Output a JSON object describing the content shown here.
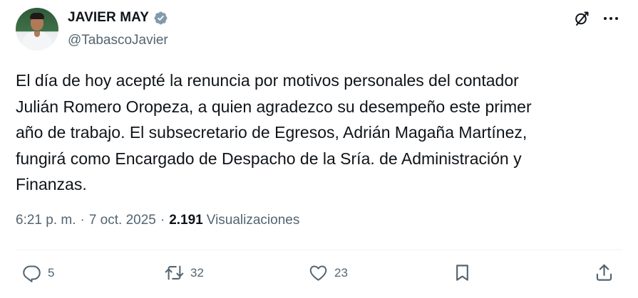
{
  "author": {
    "display_name": "JAVIER MAY",
    "handle": "@TabascoJavier",
    "verified": true,
    "verified_color": "#829aab"
  },
  "tweet": {
    "text": "El día de hoy acepté la renuncia por motivos personales del contador\nJulián Romero Oropeza, a quien agradezco su desempeño este primer\naño de trabajo. El subsecretario de Egresos, Adrián Magaña Martínez,\nfungirá como Encargado de Despacho de la Sría. de Administración y\nFinanzas.",
    "time": "6:21 p. m.",
    "date": "7 oct. 2025",
    "separator": "·",
    "views_count": "2.191",
    "views_label": "Visualizaciones"
  },
  "actions": {
    "replies": "5",
    "retweets": "32",
    "likes": "23"
  },
  "icons": {
    "header": [
      "grok-icon",
      "more-icon"
    ],
    "actions": [
      "reply-icon",
      "retweet-icon",
      "like-icon",
      "bookmark-icon",
      "share-icon"
    ]
  },
  "colors": {
    "text": "#0f1419",
    "secondary": "#536471",
    "divider": "#eff3f4"
  }
}
